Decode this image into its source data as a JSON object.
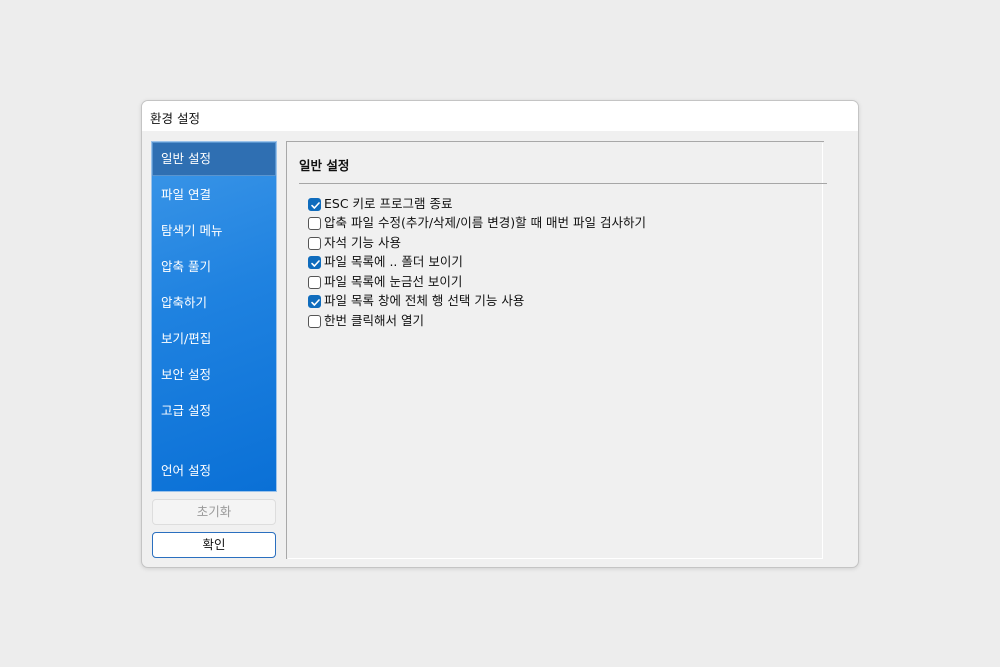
{
  "window": {
    "title": "환경 설정"
  },
  "sidebar": {
    "items": [
      {
        "label": "일반 설정",
        "active": true
      },
      {
        "label": "파일 연결",
        "active": false
      },
      {
        "label": "탐색기 메뉴",
        "active": false
      },
      {
        "label": "압축 풀기",
        "active": false
      },
      {
        "label": "압축하기",
        "active": false
      },
      {
        "label": "보기/편집",
        "active": false
      },
      {
        "label": "보안 설정",
        "active": false
      },
      {
        "label": "고급 설정",
        "active": false
      },
      {
        "label": "언어 설정",
        "active": false
      }
    ]
  },
  "buttons": {
    "reset": "초기화",
    "ok": "확인"
  },
  "panel": {
    "title": "일반 설정",
    "options": [
      {
        "label": "ESC 키로 프로그램 종료",
        "checked": true
      },
      {
        "label": "압축 파일 수정(추가/삭제/이름 변경)할 때 매번 파일 검사하기",
        "checked": false
      },
      {
        "label": "자석 기능 사용",
        "checked": false
      },
      {
        "label": "파일 목록에 .. 폴더 보이기",
        "checked": true
      },
      {
        "label": "파일 목록에 눈금선 보이기",
        "checked": false
      },
      {
        "label": "파일 목록 창에 전체 행 선택 기능 사용",
        "checked": true
      },
      {
        "label": "한번 클릭해서 열기",
        "checked": false
      }
    ]
  },
  "colors": {
    "accent": "#0f6cbd",
    "sidebar": "#1f82e0",
    "active_item": "#2f6fb2"
  }
}
